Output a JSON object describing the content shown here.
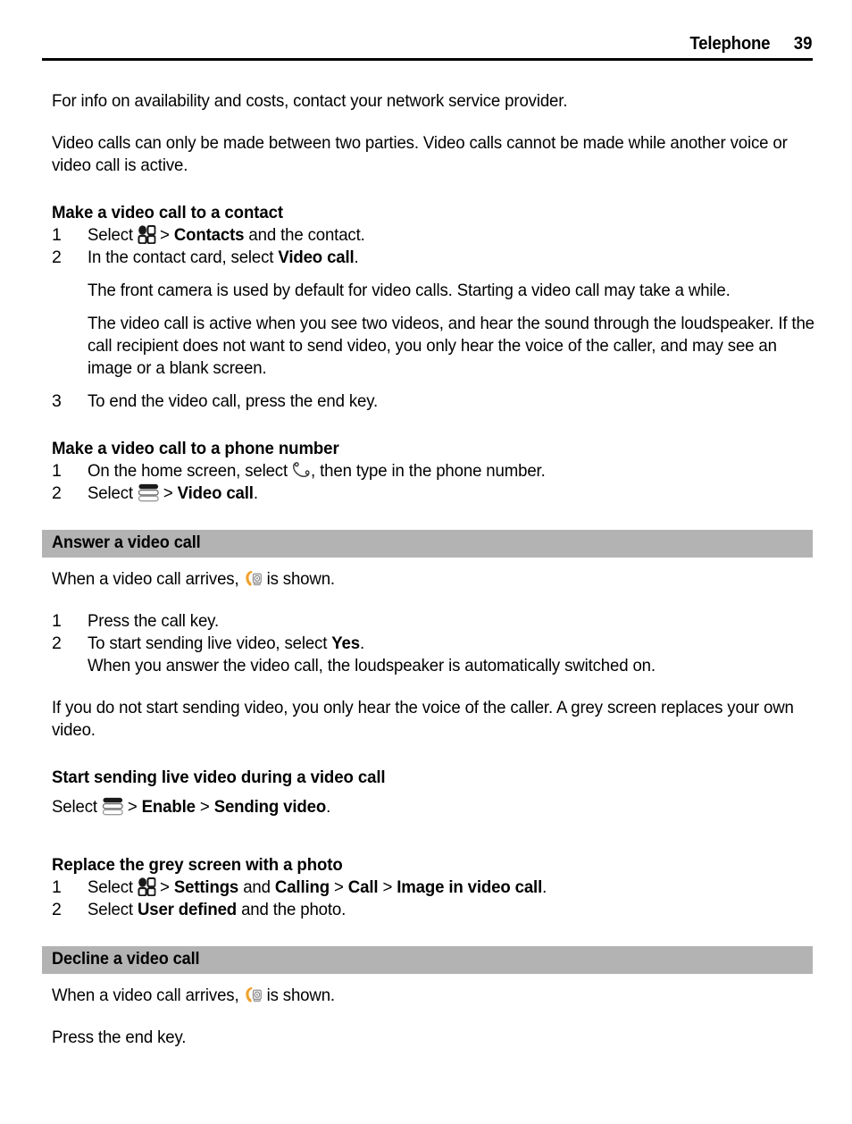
{
  "header": {
    "title": "Telephone",
    "page_number": "39"
  },
  "colors": {
    "band_background": "#b3b3b3",
    "text": "#000000",
    "video_call_icon_orange": "#f0a22e",
    "page_background": "#ffffff"
  },
  "icons": {
    "grid": "menu-grid-icon",
    "options": "options-menu-icon",
    "phone": "phone-handset-icon",
    "video_call": "video-call-icon"
  },
  "intro": {
    "paragraph_1": "For info on availability and costs, contact your network service provider.",
    "paragraph_2": "Video calls can only be made between two parties. Video calls cannot be made while another voice or video call is active."
  },
  "section_contact": {
    "heading": "Make a video call to a contact",
    "step1_pre": "Select",
    "step1_sep": ">",
    "step1_bold": "Contacts",
    "step1_post": "and the contact.",
    "step2_pre": "In the contact card, select",
    "step2_bold": "Video call",
    "step2_post": ".",
    "note1": "The front camera is used by default for video calls. Starting a video call may take a while.",
    "note2": "The video call is active when you see two videos, and hear the sound through the loudspeaker. If the call recipient does not want to send video, you only hear the voice of the caller, and may see an image or a blank screen.",
    "step3": "To end the video call, press the end key.",
    "num1": "1",
    "num2": "2",
    "num3": "3"
  },
  "section_number": {
    "heading": "Make a video call to a phone number",
    "step1_pre": "On the home screen, select",
    "step1_post": ", then type in the phone number.",
    "step2_pre": "Select",
    "step2_sep": ">",
    "step2_bold": "Video call",
    "step2_post": ".",
    "num1": "1",
    "num2": "2"
  },
  "section_answer": {
    "band_heading": "Answer a video call",
    "intro_pre": "When a video call arrives,",
    "intro_post": "is shown.",
    "step1": "Press the call key.",
    "step2_pre": "To start sending live video, select",
    "step2_bold": "Yes",
    "step2_post": ".",
    "note": "When you answer the video call, the loudspeaker is automatically switched on.",
    "outro": "If you do not start sending video, you only hear the voice of the caller. A grey screen replaces your own video.",
    "num1": "1",
    "num2": "2"
  },
  "section_live_video": {
    "heading": "Start sending live video during a video call",
    "line_pre": "Select",
    "sep1": ">",
    "bold1": "Enable",
    "sep2": ">",
    "bold2": "Sending video",
    "line_post": "."
  },
  "section_replace_photo": {
    "heading": "Replace the grey screen with a photo",
    "step1_pre": "Select",
    "step1_sep1": ">",
    "step1_bold1": "Settings",
    "step1_mid": "and",
    "step1_bold2": "Calling",
    "step1_sep2": ">",
    "step1_bold3": "Call",
    "step1_sep3": ">",
    "step1_bold4": "Image in video call",
    "step1_post": ".",
    "step2_pre": "Select",
    "step2_bold": "User defined",
    "step2_post": "and the photo.",
    "num1": "1",
    "num2": "2"
  },
  "section_decline": {
    "band_heading": "Decline a video call",
    "intro_pre": "When a video call arrives,",
    "intro_post": "is shown.",
    "outro": "Press the end key."
  }
}
